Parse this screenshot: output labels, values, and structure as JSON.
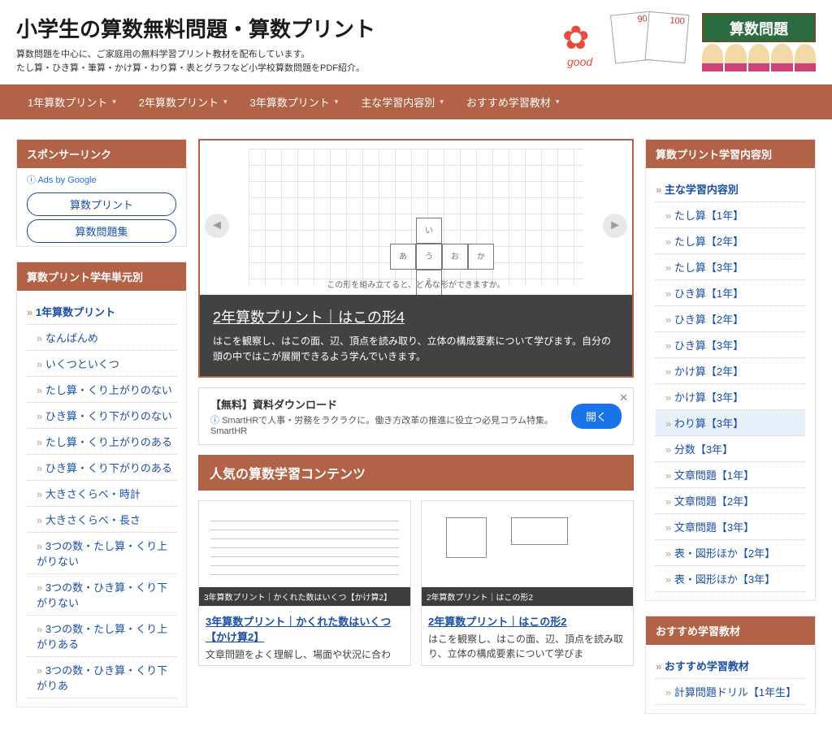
{
  "header": {
    "title": "小学生の算数無料問題・算数プリント",
    "desc1": "算数問題を中心に、ご家庭用の無料学習プリント教材を配布しています。",
    "desc2": "たし算・ひき算・筆算・かけ算・わり算・表とグラフなど小学校算数問題をPDF紹介。",
    "banner": "算数問題",
    "score1": "90",
    "score2": "100"
  },
  "nav": [
    "1年算数プリント",
    "2年算数プリント",
    "3年算数プリント",
    "主な学習内容別",
    "おすすめ学習教材"
  ],
  "sponsor": {
    "title": "スポンサーリンク",
    "ads_by": "Ads by Google",
    "pills": [
      "算数プリント",
      "算数問題集"
    ]
  },
  "left_box": {
    "title": "算数プリント学年単元別",
    "head": "1年算数プリント",
    "items": [
      "なんばんめ",
      "いくつといくつ",
      "たし算・くり上がりのない",
      "ひき算・くり下がりのない",
      "たし算・くり上がりのある",
      "ひき算・くり下がりのある",
      "大きさくらべ・時計",
      "大きさくらべ・長さ",
      "3つの数・たし算・くり上がりない",
      "3つの数・ひき算・くり下がりない",
      "3つの数・たし算・くり上がりある",
      "3つの数・ひき算・くり下がりあ"
    ]
  },
  "slider": {
    "caption_small": "この形を組み立てると、どんな形ができますか。",
    "title": "2年算数プリント｜はこの形4",
    "desc": "はこを観察し、はこの面、辺、頂点を読み取り、立体の構成要素について学びます。自分の頭の中ではこが展開できるよう学んでいきます。"
  },
  "ad": {
    "title": "【無料】資料ダウンロード",
    "sub": "SmartHRで人事・労務をラクラクに。働き方改革の推進に役立つ必見コラム特集。SmartHR",
    "btn": "開く"
  },
  "popular": {
    "title": "人気の算数学習コンテンツ"
  },
  "cards": [
    {
      "tag": "3年算数プリント｜かくれた数はいくつ【かけ算2】",
      "title": "3年算数プリント｜かくれた数はいくつ【かけ算2】",
      "desc": "文章問題をよく理解し、場面や状況に合わ"
    },
    {
      "tag": "2年算数プリント｜はこの形2",
      "title": "2年算数プリント｜はこの形2",
      "desc": "はこを観察し、はこの面、辺、頂点を読み取り、立体の構成要素について学びま"
    }
  ],
  "right_box": {
    "title": "算数プリント学習内容別",
    "head": "主な学習内容別",
    "items": [
      "たし算【1年】",
      "たし算【2年】",
      "たし算【3年】",
      "ひき算【1年】",
      "ひき算【2年】",
      "ひき算【3年】",
      "かけ算【2年】",
      "かけ算【3年】",
      "わり算【3年】",
      "分数【3年】",
      "文章問題【1年】",
      "文章問題【2年】",
      "文章問題【3年】",
      "表・図形ほか【2年】",
      "表・図形ほか【3年】"
    ],
    "highlight_index": 8
  },
  "rec_box": {
    "title": "おすすめ学習教材",
    "head": "おすすめ学習教材",
    "items": [
      "計算問題ドリル【1年生】"
    ]
  }
}
